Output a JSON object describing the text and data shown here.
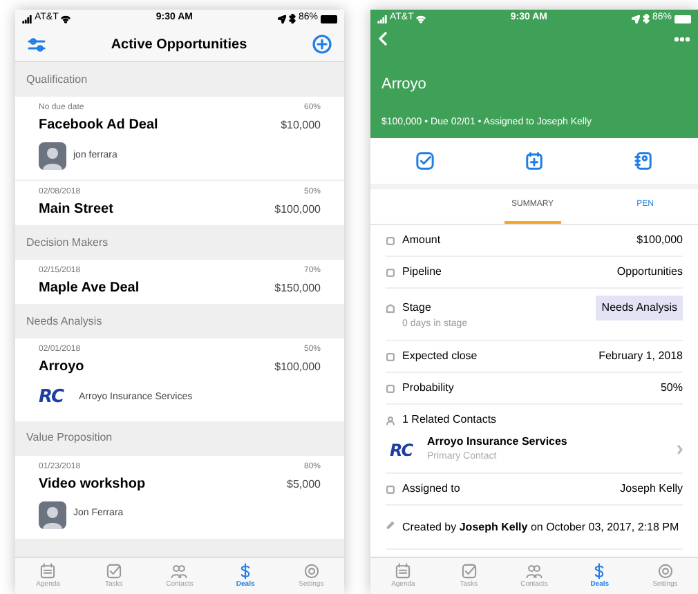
{
  "left_phone": {
    "status_bar": {
      "carrier": "AT&T",
      "time": "9:30 AM",
      "battery": "86%"
    },
    "header": {
      "title": "Active Opportunities"
    },
    "sections": [
      {
        "title": "Qualification",
        "deals": [
          {
            "date": "No due date",
            "probability": "60%",
            "name": "Facebook Ad Deal",
            "amount": "$10,000",
            "contact": {
              "kind": "person",
              "name": "jon ferrara"
            }
          },
          {
            "date": "02/08/2018",
            "probability": "50%",
            "name": "Main Street",
            "amount": "$100,000"
          }
        ]
      },
      {
        "title": "Decision Makers",
        "deals": [
          {
            "date": "02/15/2018",
            "probability": "70%",
            "name": "Maple Ave Deal",
            "amount": "$150,000"
          }
        ]
      },
      {
        "title": "Needs Analysis",
        "deals": [
          {
            "date": "02/01/2018",
            "probability": "50%",
            "name": "Arroyo",
            "amount": "$100,000",
            "contact": {
              "kind": "company",
              "logo": "RC",
              "name": "Arroyo Insurance Services"
            }
          }
        ]
      },
      {
        "title": "Value Proposition",
        "deals": [
          {
            "date": "01/23/2018",
            "probability": "80%",
            "name": "Video workshop",
            "amount": "$5,000",
            "contact": {
              "kind": "person",
              "name": "Jon Ferrara"
            }
          }
        ]
      }
    ],
    "tab_bar": [
      {
        "label": "Agenda",
        "selected": false
      },
      {
        "label": "Tasks",
        "selected": false
      },
      {
        "label": "Contacts",
        "selected": false
      },
      {
        "label": "Deals",
        "selected": true
      },
      {
        "label": "Settings",
        "selected": false
      }
    ]
  },
  "right_phone": {
    "status_bar": {
      "carrier": "AT&T",
      "time": "9:30 AM",
      "battery": "86%"
    },
    "header": {
      "title": "Arroyo",
      "subtitle": "$100,000 • Due 02/01 • Assigned to Joseph Kelly"
    },
    "tabs": [
      {
        "label": "SUMMARY",
        "selected": true
      },
      {
        "label": "PEN",
        "selected": false
      }
    ],
    "fields": [
      {
        "kind": "pair",
        "label": "Amount",
        "value": "$100,000"
      },
      {
        "kind": "pair",
        "label": "Pipeline",
        "value": "Opportunities"
      },
      {
        "kind": "stage",
        "label": "Stage",
        "note": "0 days in stage",
        "value": "Needs Analysis"
      },
      {
        "kind": "pair",
        "label": "Expected close",
        "value": "February 1, 2018"
      },
      {
        "kind": "pair",
        "label": "Probability",
        "value": "50%"
      },
      {
        "kind": "contacts",
        "label": "1 Related Contacts",
        "logo": "RC",
        "name": "Arroyo Insurance Services",
        "role": "Primary Contact"
      },
      {
        "kind": "pair",
        "label": "Assigned to",
        "value": "Joseph Kelly"
      },
      {
        "kind": "note",
        "text": "Created by **Joseph Kelly** on October 03, 2017, 2:18 PM"
      }
    ],
    "tab_bar": [
      {
        "label": "Agenda",
        "selected": false
      },
      {
        "label": "Tasks",
        "selected": false
      },
      {
        "label": "Contacts",
        "selected": false
      },
      {
        "label": "Deals",
        "selected": true
      },
      {
        "label": "Settings",
        "selected": false
      }
    ]
  }
}
